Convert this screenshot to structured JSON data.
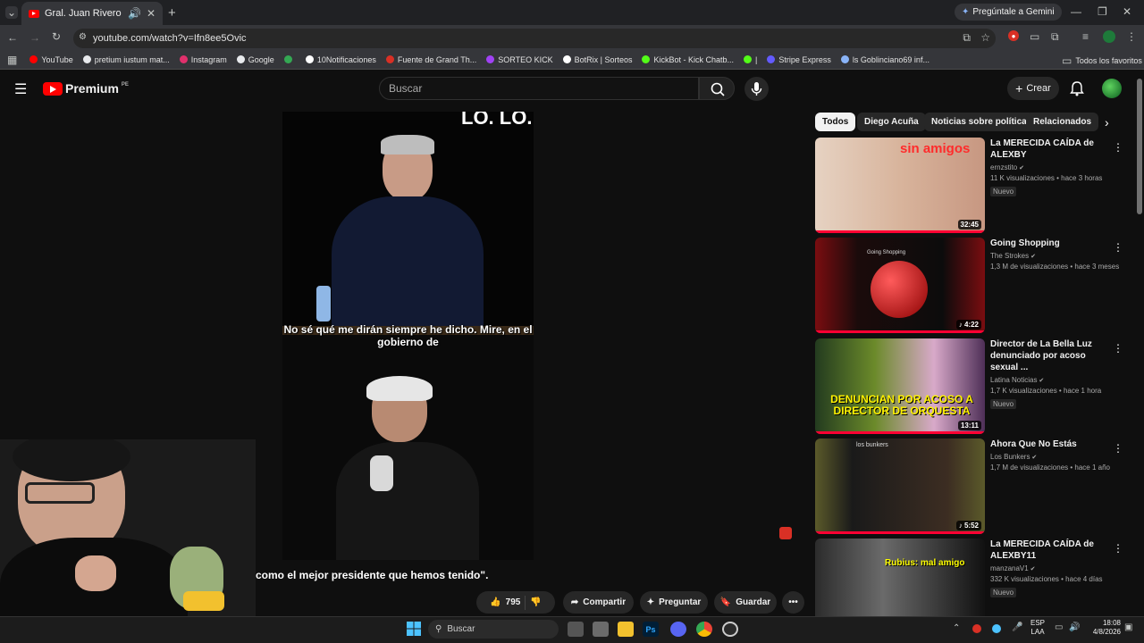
{
  "browser": {
    "tab_title": "Gral. Juan Rivero Lazo: \"Con",
    "url": "youtube.com/watch?v=Ifn8ee5Ovic",
    "gemini_label": "Pregúntale a Gemini",
    "bookmarks": [
      {
        "label": "YouTube",
        "color": "#ff0000"
      },
      {
        "label": "pretium iustum mat...",
        "color": "#e8eaed"
      },
      {
        "label": "Instagram",
        "color": "#e1306c"
      },
      {
        "label": "Google",
        "color": "#e8eaed"
      },
      {
        "label": "",
        "color": "#34a853"
      },
      {
        "label": "10Notificaciones",
        "color": "#ffffff"
      },
      {
        "label": "Fuente de Grand Th...",
        "color": "#d93025"
      },
      {
        "label": "SORTEO KICK",
        "color": "#a142f4"
      },
      {
        "label": "BotRix | Sorteos",
        "color": "#ffffff"
      },
      {
        "label": "KickBot - Kick Chatb...",
        "color": "#53fc18"
      },
      {
        "label": "|",
        "color": "#53fc18"
      },
      {
        "label": "Stripe Express",
        "color": "#635bff"
      },
      {
        "label": "ls Goblinciano69 inf...",
        "color": "#8ab4f8"
      }
    ],
    "all_favorites": "Todos los favoritos"
  },
  "header": {
    "logo_text": "Premium",
    "logo_sup": "PE",
    "search_placeholder": "Buscar",
    "create_label": "Crear"
  },
  "video": {
    "overlay_top": "LO. LO.",
    "caption": "No sé qué me dirán siempre he dicho. Mire, en el gobierno de",
    "subtitle": "como el mejor presidente que hemos tenido\"."
  },
  "actions": {
    "likes": "795",
    "share": "Compartir",
    "ask": "Preguntar",
    "save": "Guardar"
  },
  "chips": [
    "Todos",
    "Diego Acuña",
    "Noticias sobre política",
    "Relacionados"
  ],
  "recommendations": [
    {
      "title": "La MERECIDA CAÍDA de ALEXBY",
      "channel": "ernzstito",
      "meta": "11 K visualizaciones • hace 3 horas",
      "badge": "Nuevo",
      "duration": "32:45",
      "thumb_text": "sin amigos",
      "music": false
    },
    {
      "title": "Going Shopping",
      "channel": "The Strokes",
      "meta": "1,3 M de visualizaciones • hace 3 meses",
      "badge": "",
      "duration": "4:22",
      "thumb_text": "Going Shopping",
      "music": true
    },
    {
      "title": "Director de La Bella Luz denunciado por acoso sexual ...",
      "channel": "Latina Noticias",
      "meta": "1,7 K visualizaciones • hace 1 hora",
      "badge": "Nuevo",
      "duration": "13:11",
      "thumb_text": "DENUNCIAN POR ACOSO A DIRECTOR DE ORQUESTA",
      "music": false
    },
    {
      "title": "Ahora Que No Estás",
      "channel": "Los Bunkers",
      "meta": "1,7 M de visualizaciones • hace 1 año",
      "badge": "",
      "duration": "5:52",
      "thumb_text": "los bunkers",
      "music": true
    },
    {
      "title": "La MERECIDA CAÍDA de ALEXBY11",
      "channel": "manzanaV1",
      "meta": "332 K visualizaciones • hace 4 días",
      "badge": "Nuevo",
      "duration": "",
      "thumb_text": "Rubius: mal amigo",
      "music": false
    }
  ],
  "taskbar": {
    "search": "Buscar",
    "lang": "ESP",
    "lang2": "LAA",
    "time": "18:08",
    "date": "4/8/2026"
  }
}
